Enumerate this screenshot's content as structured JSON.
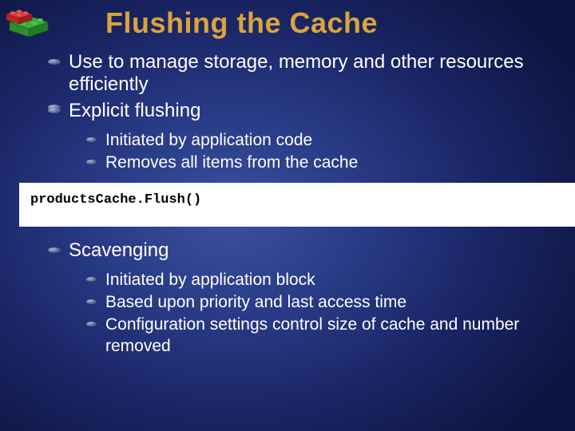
{
  "title": "Flushing the Cache",
  "bullets": {
    "item0": "Use to manage storage, memory and other resources efficiently",
    "item1": "Explicit flushing",
    "item1_sub": {
      "s0": "Initiated by application code",
      "s1": "Removes all items from the cache"
    },
    "codeblock": "productsCache.Flush()",
    "item2": "Scavenging",
    "item2_sub": {
      "s0": "Initiated by application block",
      "s1": "Based upon priority and last access time",
      "s2": "Configuration settings control size of cache and number removed"
    }
  }
}
